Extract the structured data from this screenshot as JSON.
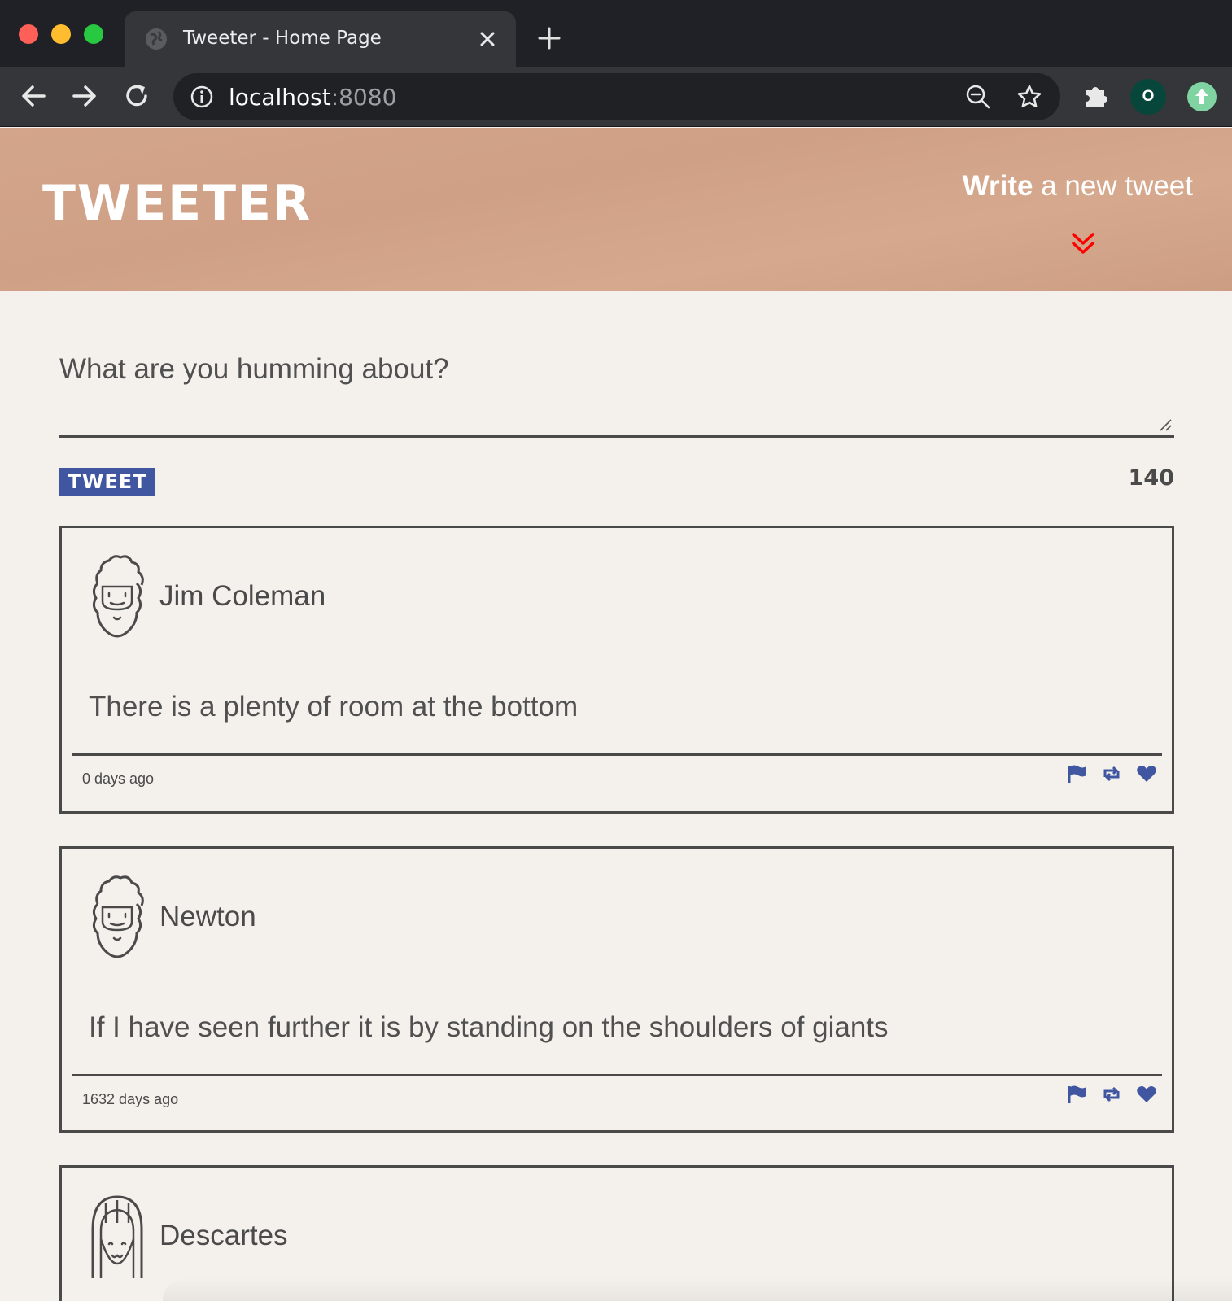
{
  "browser": {
    "tab_title": "Tweeter - Home Page",
    "url_host": "localhost",
    "url_port": ":8080",
    "profile_initial": "O"
  },
  "header": {
    "logo": "TWEETER",
    "compose_toggle_bold": "Write",
    "compose_toggle_rest": " a new tweet",
    "chevron_color": "#ff0000"
  },
  "compose": {
    "placeholder": "What are you humming about?",
    "button_label": "TWEET",
    "counter": "140"
  },
  "tweets": [
    {
      "author": "Jim Coleman",
      "text": "There is a plenty of room at the bottom",
      "timestamp": "0 days ago",
      "avatar_icon": "curly-hair-avatar-icon"
    },
    {
      "author": "Newton",
      "text": "If I have seen further it is by standing on the shoulders of giants",
      "timestamp": "1632 days ago",
      "avatar_icon": "curly-hair-avatar-icon"
    },
    {
      "author": "Descartes",
      "text": "",
      "timestamp": "",
      "avatar_icon": "long-hair-avatar-icon"
    }
  ],
  "colors": {
    "accent": "#4056a1",
    "header_bg": "#d3a58b",
    "page_bg": "#f4f1ec",
    "text": "#4a4a4a"
  }
}
